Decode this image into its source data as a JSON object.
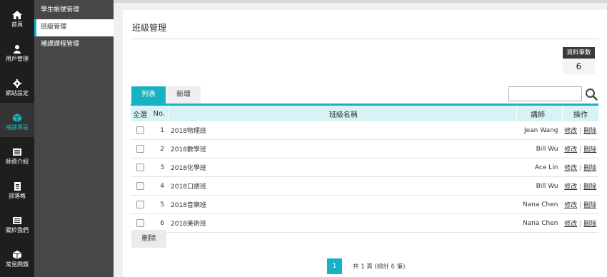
{
  "rail": [
    {
      "label": "首頁",
      "icon": "home-icon",
      "active": false
    },
    {
      "label": "用戶管理",
      "icon": "user-icon",
      "active": false
    },
    {
      "label": "網站設定",
      "icon": "gear-icon",
      "active": false
    },
    {
      "label": "補課專區",
      "icon": "cube-icon",
      "active": true
    },
    {
      "label": "師資介紹",
      "icon": "list-icon",
      "active": false
    },
    {
      "label": "部落格",
      "icon": "document-icon",
      "active": false
    },
    {
      "label": "關於我們",
      "icon": "list-icon",
      "active": false
    },
    {
      "label": "常見問題",
      "icon": "cube-icon",
      "active": false
    }
  ],
  "submenu": [
    {
      "label": "學生帳號管理",
      "active": false
    },
    {
      "label": "班級管理",
      "active": true
    },
    {
      "label": "補課課程管理",
      "active": false
    }
  ],
  "page": {
    "title": "班級管理"
  },
  "count": {
    "label": "資料筆數",
    "value": "6"
  },
  "tabs": [
    {
      "label": "列表",
      "active": true
    },
    {
      "label": "新增",
      "active": false
    }
  ],
  "search": {
    "placeholder": "",
    "value": ""
  },
  "table": {
    "headers": {
      "select_all": "全選",
      "no": "No.",
      "name": "班級名稱",
      "teacher": "講師",
      "action": "操作"
    },
    "rows": [
      {
        "no": "1",
        "name": "2018物理班",
        "teacher": "Jean Wang"
      },
      {
        "no": "2",
        "name": "2018數學班",
        "teacher": "Bill Wu"
      },
      {
        "no": "3",
        "name": "2018化學班",
        "teacher": "Ace Lin"
      },
      {
        "no": "4",
        "name": "2018口語班",
        "teacher": "Bill Wu"
      },
      {
        "no": "5",
        "name": "2018音樂班",
        "teacher": "Nana Chen"
      },
      {
        "no": "6",
        "name": "2018美術班",
        "teacher": "Nana Chen"
      }
    ],
    "edit_label": "修改",
    "separator": "|",
    "delete_label": "刪除"
  },
  "delete_button": "刪除",
  "pagination": {
    "current": "1",
    "info": "共 1 頁 (總計 6 筆)"
  },
  "colors": {
    "accent": "#17b3c4",
    "rail": "#1e1e1e",
    "submenu": "#474747"
  }
}
